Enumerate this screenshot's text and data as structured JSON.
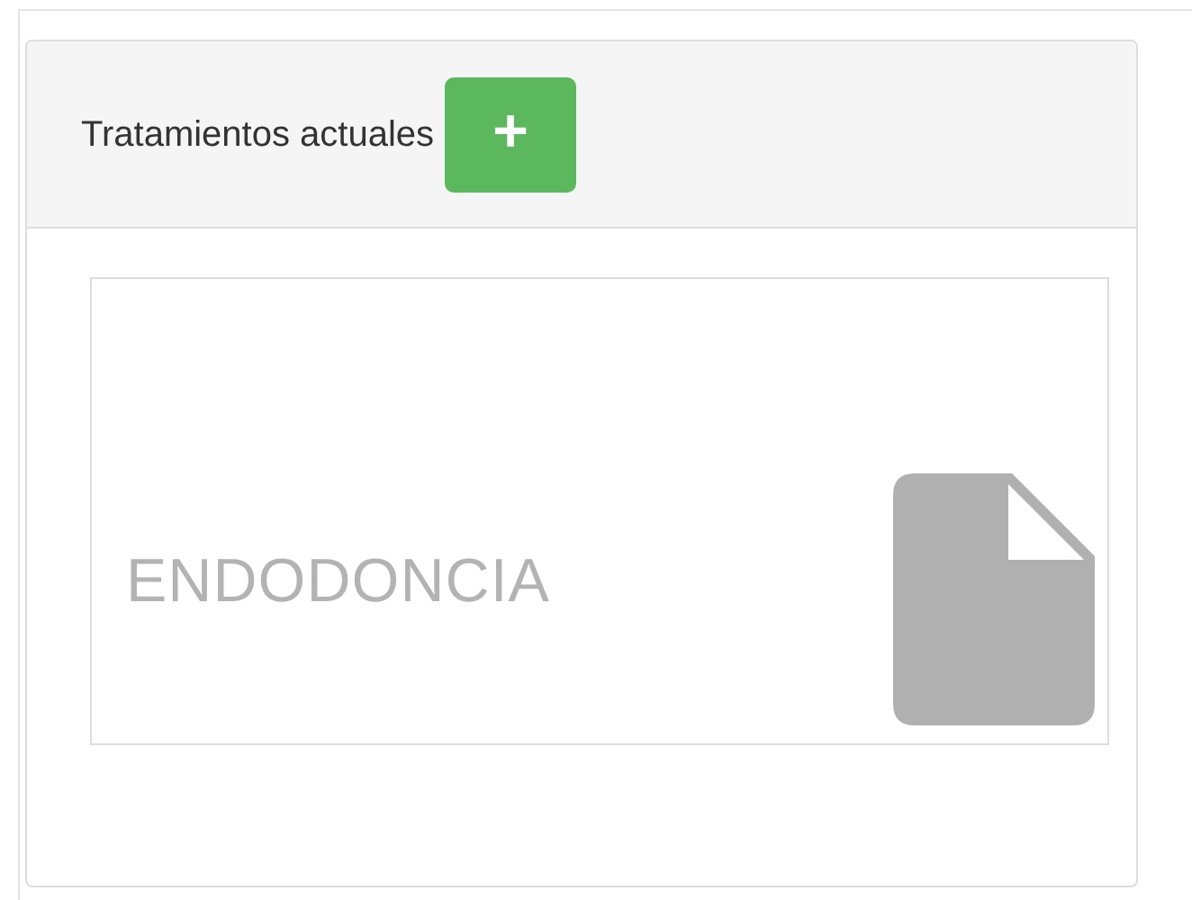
{
  "panel": {
    "title": "Tratamientos actuales",
    "add_button": "+"
  },
  "treatments": [
    {
      "name": "ENDODONCIA"
    }
  ]
}
